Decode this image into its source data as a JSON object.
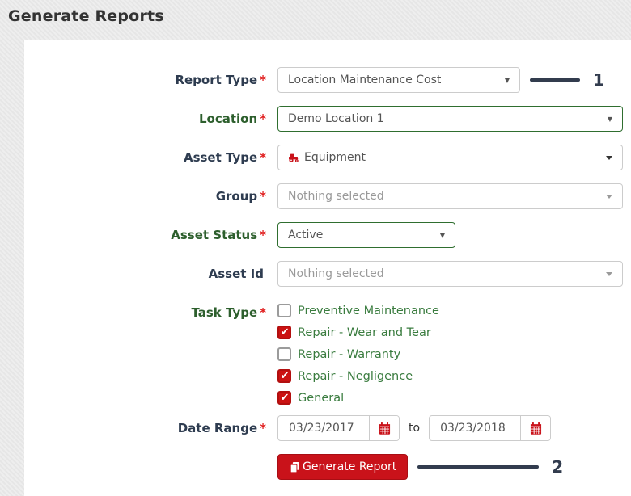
{
  "page_title": "Generate Reports",
  "fields": {
    "report_type": {
      "label": "Report Type",
      "required": "*",
      "value": "Location Maintenance Cost"
    },
    "location": {
      "label": "Location",
      "required": "*",
      "value": "Demo Location 1"
    },
    "asset_type": {
      "label": "Asset Type",
      "required": "*",
      "value": "Equipment",
      "icon": "equipment-icon"
    },
    "group": {
      "label": "Group",
      "required": "*",
      "placeholder": "Nothing selected"
    },
    "asset_status": {
      "label": "Asset Status",
      "required": "*",
      "value": "Active"
    },
    "asset_id": {
      "label": "Asset Id",
      "required": "",
      "placeholder": "Nothing selected"
    },
    "task_type": {
      "label": "Task Type",
      "required": "*",
      "options": [
        {
          "label": "Preventive Maintenance",
          "checked": false
        },
        {
          "label": "Repair - Wear and Tear",
          "checked": true
        },
        {
          "label": "Repair - Warranty",
          "checked": false
        },
        {
          "label": "Repair - Negligence",
          "checked": true
        },
        {
          "label": "General",
          "checked": true
        }
      ]
    },
    "date_range": {
      "label": "Date Range",
      "required": "*",
      "from": "03/23/2017",
      "separator": "to",
      "to": "03/23/2018"
    }
  },
  "button": {
    "label": "Generate Report",
    "icon": "generate-report-icon"
  },
  "annotations": {
    "step1": "1",
    "step2": "2"
  },
  "colors": {
    "brand_red": "#c9121a",
    "checkbox_red": "#cb1212",
    "label_navy": "#2e3c50",
    "label_green": "#2d5f2d",
    "checkbox_label_green": "#3a7c3f",
    "border_green": "#2f6e2f",
    "border_gray": "#cccccc",
    "muted_text": "#999999",
    "select_text": "#555555",
    "annotation": "#323c4e",
    "page_bg": "#e9e9e9"
  }
}
